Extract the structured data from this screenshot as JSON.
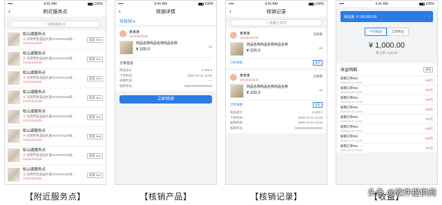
{
  "status": {
    "signal": "•••••",
    "time": "9:41 AM",
    "battery": "100%"
  },
  "screen1": {
    "title": "附近服务点",
    "search_placeholder": "搜索服务点",
    "items": [
      {
        "name": "松山湖服务点",
        "addr": "东莞市生态园大道XXXXXX120号...",
        "phone": "13131313130",
        "dist": "距离 2km"
      },
      {
        "name": "松山湖服务点",
        "addr": "东莞市生态园大道XXXXXX120号...",
        "phone": "13131313130",
        "dist": "距离 2km"
      },
      {
        "name": "松山湖服务点",
        "addr": "东莞市生态园大道XXXXXX120号...",
        "phone": "13131313130",
        "dist": "距离 2km"
      },
      {
        "name": "松山湖服务点",
        "addr": "东莞市生态园大道XXXXXX120号...",
        "phone": "13131313130",
        "dist": "距离 2km"
      },
      {
        "name": "松山湖服务点",
        "addr": "东莞市生态园大道XXXXXX120号...",
        "phone": "13131313130",
        "dist": "距离 2km"
      },
      {
        "name": "松山湖服务点",
        "addr": "东莞市生态园大道XXXXXX120号...",
        "phone": "13131313130",
        "dist": "距离 2km"
      },
      {
        "name": "松山湖服务点",
        "addr": "东莞市生态园大道XXXXXX120号...",
        "phone": "13131313130",
        "dist": "距离 2km"
      },
      {
        "name": "松山湖服务点",
        "addr": "东莞市生态园大道XXXXXX120号...",
        "phone": "13131313130",
        "dist": "距离 2km"
      }
    ],
    "caption": "【附近服务点】"
  },
  "screen2": {
    "title": "核销详情",
    "tab": "待核销 ▾",
    "user_name": "某某某",
    "user_phone": "13131313131",
    "goods_name": "商品名称商品名称商品名称",
    "price": "¥ 200.0",
    "qty": "x2",
    "order_title": "订单信息",
    "rows": [
      {
        "k": "商品总价",
        "v": "¥ 400.0"
      },
      {
        "k": "下单时间",
        "v": "2020-10-01 12:00"
      },
      {
        "k": "核销时间",
        "v": "—"
      },
      {
        "k": "核销单号",
        "v": "3045353453453534"
      }
    ],
    "button": "立即核销",
    "caption": "【核销产品】"
  },
  "screen3": {
    "title": "核销记录",
    "search_placeholder": "搜索订单号",
    "rec1": {
      "user": "某某某",
      "phone": "13131313131",
      "status": "已核销",
      "goods": "商品名称商品名称商品名称",
      "price": "¥ 200.0",
      "qty": "x2",
      "link": "订单详情",
      "tag": "展开"
    },
    "rec2": {
      "user": "某某某",
      "phone": "13131313131",
      "status": "已核销",
      "goods": "商品名称商品名称商品名称",
      "price": "¥ 200.0",
      "qty": "x2",
      "link": "订单详情",
      "tag": "收起"
    },
    "rows": [
      {
        "k": "商品总价",
        "v": "¥ 400.0"
      },
      {
        "k": "下单时间",
        "v": "2020-10-01 12:00"
      },
      {
        "k": "核销时间",
        "v": "2020-10-01 12:00"
      },
      {
        "k": "核销单号",
        "v": "3045353453453534"
      }
    ],
    "caption": "【核销记录】"
  },
  "screen4": {
    "banner_left": "保证金: ¥ 100,000.00",
    "banner_right": "›",
    "tab_today": "今日收益",
    "tab_all": "全部收益",
    "amount": "¥ 1,000.00",
    "sub_label": "较上日",
    "sub_value": "+100.00",
    "detail_title": "收益明细",
    "filter": "筛选",
    "rows": [
      {
        "title": "核销订单001",
        "date": "2020-01-01 12:00",
        "amt": "+50元"
      },
      {
        "title": "核销订单001",
        "date": "2020-01-01 12:00",
        "amt": "+50元"
      },
      {
        "title": "核销订单001",
        "date": "2020-01-01 12:00",
        "amt": "+50元"
      },
      {
        "title": "核销订单001",
        "date": "2020-01-01 12:00",
        "amt": "+50元"
      },
      {
        "title": "核销订单001",
        "date": "2020-01-01 12:00",
        "amt": "+50元"
      },
      {
        "title": "核销订单001",
        "date": "2020-01-01 12:00",
        "amt": "+50元"
      },
      {
        "title": "核销订单001",
        "date": "2020-01-01 12:00",
        "amt": "+50元"
      },
      {
        "title": "核销订单001",
        "date": "2020-01-01 12:00",
        "amt": "+50元"
      }
    ],
    "caption": "【收益】"
  },
  "watermark": "头条 @软件提供商"
}
